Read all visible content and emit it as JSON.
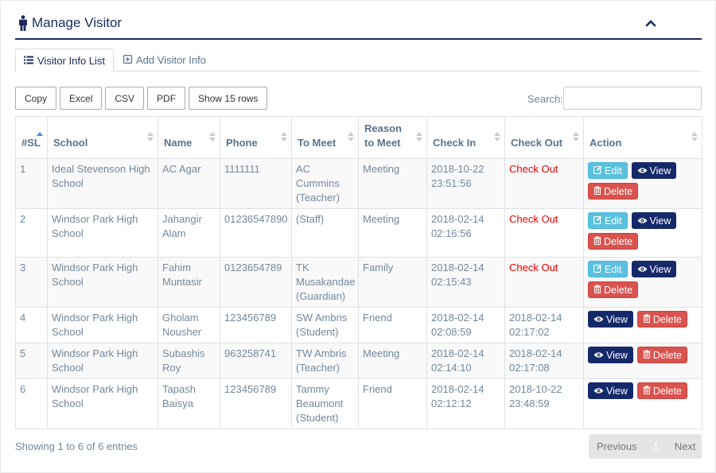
{
  "header": {
    "title": "Manage Visitor"
  },
  "tabs": [
    {
      "label": "Visitor Info List",
      "active": true
    },
    {
      "label": "Add Visitor Info",
      "active": false
    }
  ],
  "export_buttons": [
    "Copy",
    "Excel",
    "CSV",
    "PDF",
    "Show 15 rows"
  ],
  "search": {
    "label": "Search:",
    "value": ""
  },
  "table": {
    "columns": [
      "#SL",
      "School",
      "Name",
      "Phone",
      "To Meet",
      "Reason to Meet",
      "Check In",
      "Check Out",
      "Action"
    ],
    "rows": [
      {
        "sl": "1",
        "school": "Ideal Stevenson High School",
        "name": "AC Agar",
        "phone": "1111111",
        "to_meet": "AC Cummins (Teacher)",
        "reason": "Meeting",
        "check_in": "2018-10-22 23:51:56",
        "check_out": "Check Out",
        "checked_out": false
      },
      {
        "sl": "2",
        "school": "Windsor Park High School",
        "name": "Jahangir Alam",
        "phone": "01236547890",
        "to_meet": "(Staff)",
        "reason": "Meeting",
        "check_in": "2018-02-14 02:16:56",
        "check_out": "Check Out",
        "checked_out": false
      },
      {
        "sl": "3",
        "school": "Windsor Park High School",
        "name": "Fahim Muntasir",
        "phone": "0123654789",
        "to_meet": "TK Musakandae (Guardian)",
        "reason": "Family",
        "check_in": "2018-02-14 02:15:43",
        "check_out": "Check Out",
        "checked_out": false
      },
      {
        "sl": "4",
        "school": "Windsor Park High School",
        "name": "Gholam Nousher",
        "phone": "123456789",
        "to_meet": "SW Ambris (Student)",
        "reason": "Friend",
        "check_in": "2018-02-14 02:08:59",
        "check_out": "2018-02-14 02:17:02",
        "checked_out": true
      },
      {
        "sl": "5",
        "school": "Windsor Park High School",
        "name": "Subashis Roy",
        "phone": "963258741",
        "to_meet": "TW Ambris (Teacher)",
        "reason": "Meeting",
        "check_in": "2018-02-14 02:14:10",
        "check_out": "2018-02-14 02:17:08",
        "checked_out": true
      },
      {
        "sl": "6",
        "school": "Windsor Park High School",
        "name": "Tapash Baisya",
        "phone": "123456789",
        "to_meet": "Tammy Beaumont (Student)",
        "reason": "Friend",
        "check_in": "2018-02-14 02:12:12",
        "check_out": "2018-10-22 23:48:59",
        "checked_out": true
      }
    ],
    "action_labels": {
      "edit": "Edit",
      "view": "View",
      "delete": "Delete"
    }
  },
  "footer": {
    "info": "Showing 1 to 6 of 6 entries",
    "prev": "Previous",
    "page": "1",
    "next": "Next"
  },
  "icons": {
    "title": "male-icon",
    "collapse": "chevron-up-icon",
    "tab_list": "list-icon",
    "tab_add": "plus-square-icon",
    "edit": "edit-icon",
    "view": "eye-icon",
    "delete": "trash-icon"
  },
  "colors": {
    "brand": "#1b2a5c",
    "edit": "#5bc0de",
    "view": "#15296a",
    "delete": "#d9534f",
    "checkout_link": "#ee0000"
  }
}
